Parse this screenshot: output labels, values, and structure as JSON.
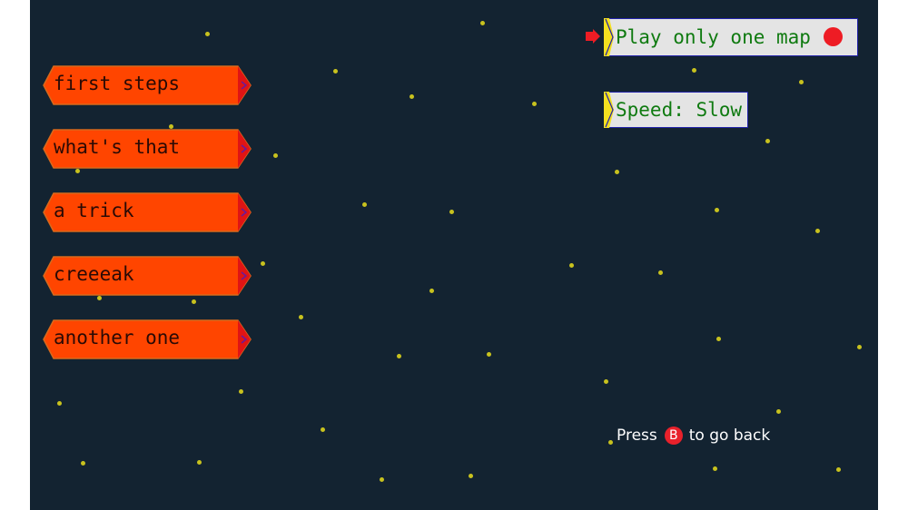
{
  "levels": [
    {
      "label": "first steps"
    },
    {
      "label": "what's that"
    },
    {
      "label": "a trick"
    },
    {
      "label": "creeeak"
    },
    {
      "label": "another one"
    }
  ],
  "options": {
    "play_only_one_map": "Play only one map",
    "speed": "Speed: Slow"
  },
  "hint": {
    "prefix": "Press",
    "button": "B",
    "suffix": "to go back"
  },
  "colors": {
    "background": "#132331",
    "level_button": "#ff4500",
    "option_text": "#0f7a10",
    "star": "#c8c21e",
    "toggle_indicator": "#ee1c24"
  }
}
